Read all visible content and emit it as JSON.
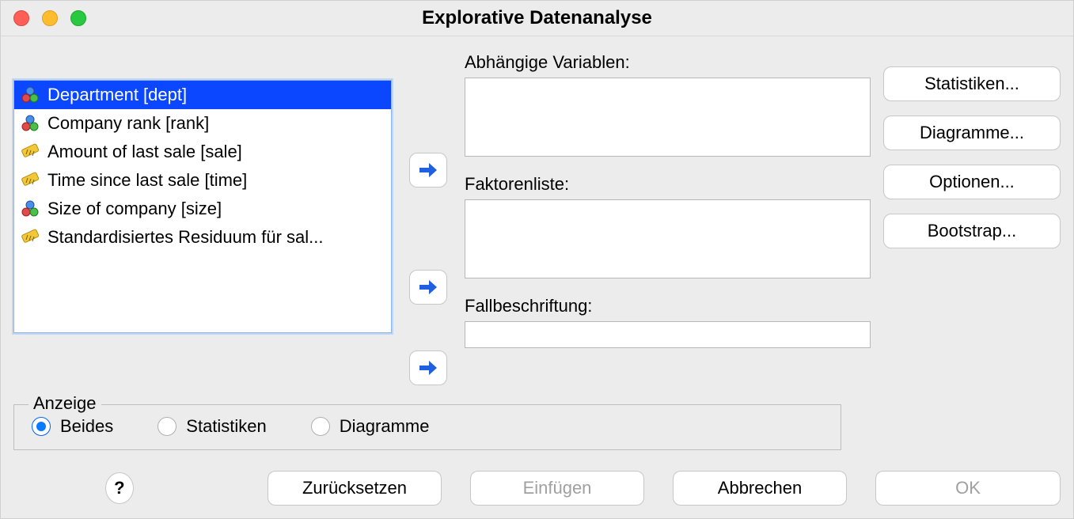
{
  "window": {
    "title": "Explorative Datenanalyse"
  },
  "variables": [
    {
      "label": "Department [dept]",
      "icon": "nominal",
      "selected": true
    },
    {
      "label": "Company rank [rank]",
      "icon": "nominal",
      "selected": false
    },
    {
      "label": "Amount of last sale [sale]",
      "icon": "scale",
      "selected": false
    },
    {
      "label": "Time since last sale [time]",
      "icon": "scale",
      "selected": false
    },
    {
      "label": "Size of company [size]",
      "icon": "nominal",
      "selected": false
    },
    {
      "label": "Standardisiertes Residuum für sal...",
      "icon": "scale",
      "selected": false
    }
  ],
  "targets": {
    "dependent_label": "Abhängige Variablen:",
    "factor_label": "Faktorenliste:",
    "caselabel_label": "Fallbeschriftung:"
  },
  "side_buttons": {
    "stats": "Statistiken...",
    "plots": "Diagramme...",
    "options": "Optionen...",
    "bootstrap": "Bootstrap..."
  },
  "anzeige": {
    "legend": "Anzeige",
    "both": "Beides",
    "stats": "Statistiken",
    "plots": "Diagramme",
    "selected": "both"
  },
  "bottom": {
    "help": "?",
    "reset": "Zurücksetzen",
    "paste": "Einfügen",
    "cancel": "Abbrechen",
    "ok": "OK"
  }
}
